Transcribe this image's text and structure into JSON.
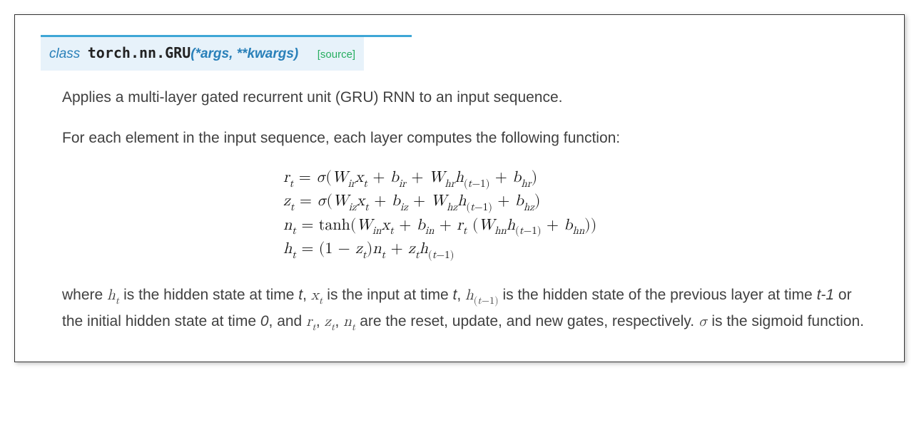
{
  "signature": {
    "class_keyword": "class",
    "qualname": "torch.nn.GRU",
    "params": "(*args, **kwargs)",
    "source_label": "[source]"
  },
  "paragraphs": {
    "intro": "Applies a multi-layer gated recurrent unit (GRU) RNN to an input sequence.",
    "lead": "For each element in the input sequence, each layer computes the following function:"
  },
  "equations": {
    "rt": "r_t = σ(W_{ir} x_t + b_{ir} + W_{hr} h_{(t-1)} + b_{hr})",
    "zt": "z_t = σ(W_{iz} x_t + b_{iz} + W_{hz} h_{(t-1)} + b_{hz})",
    "nt": "n_t = tanh(W_{in} x_t + b_{in} + r_t (W_{hn} h_{(t-1)} + b_{hn}))",
    "ht": "h_t = (1 - z_t) n_t + z_t h_{(t-1)}"
  },
  "description": {
    "txt1": "where ",
    "ht_var": "h_t",
    "txt2": " is the hidden state at time ",
    "t1": "t",
    "txt3": ", ",
    "xt_var": "x_t",
    "txt4": " is the input at time ",
    "t2": "t",
    "txt5": ", ",
    "htm1_var": "h_{(t-1)}",
    "txt6": " is the hidden state of the previous layer at time ",
    "tminus1": "t-1",
    "txt7": " or the initial hidden state at time ",
    "zero": "0",
    "txt8": ", and ",
    "rt_var": "r_t",
    "comma1": ", ",
    "zt_var": "z_t",
    "comma2": ", ",
    "nt_var": "n_t",
    "txt9": " are the reset, update, and new gates, respectively. ",
    "sigma": "σ",
    "txt10": " is the sigmoid function."
  }
}
